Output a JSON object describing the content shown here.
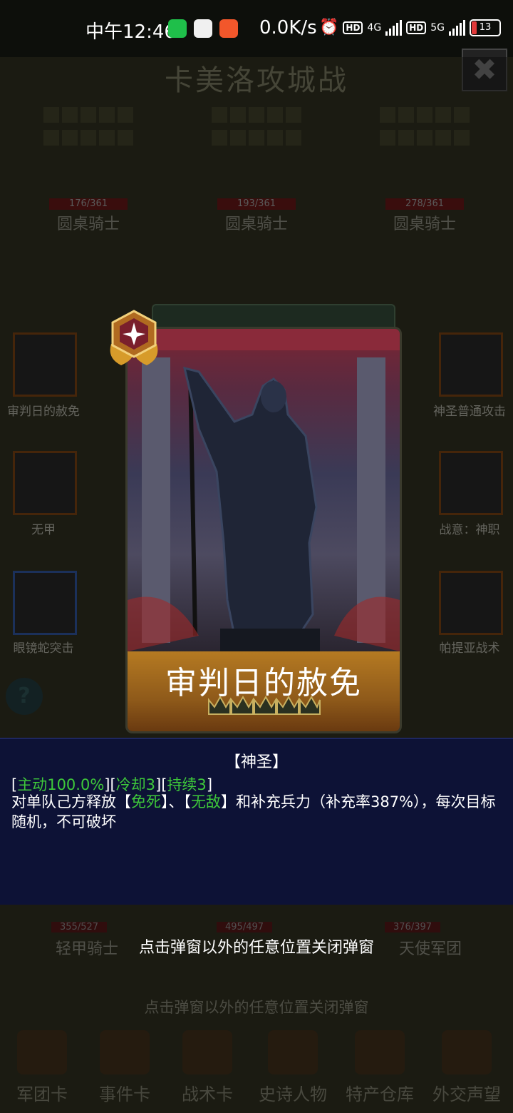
{
  "status_bar": {
    "time": "中午12:46",
    "net_speed": "0.0K/s",
    "network_1": "4G",
    "network_2": "5G",
    "battery": "13"
  },
  "game": {
    "title": "卡美洛攻城战",
    "top_units": [
      {
        "hp": "176/361",
        "name": "圆桌骑士"
      },
      {
        "hp": "193/361",
        "name": "圆桌骑士"
      },
      {
        "hp": "278/361",
        "name": "圆桌骑士"
      }
    ],
    "left_cards": [
      "审判日的赦免",
      "无甲",
      "眼镜蛇突击"
    ],
    "right_cards": [
      "神圣普通攻击",
      "战意：神职",
      "帕提亚战术"
    ],
    "help_icon": "?",
    "bottom_units": [
      {
        "hp": "355/527",
        "name": "轻甲骑士"
      },
      {
        "hp": "495/497",
        "name": ""
      },
      {
        "hp": "376/397",
        "name": "天使军团"
      }
    ],
    "bottom_hint": "点击弹窗以外的任意位置关闭弹窗",
    "nav": [
      "军团卡",
      "事件卡",
      "战术卡",
      "史诗人物",
      "特产仓库",
      "外交声望"
    ]
  },
  "popup": {
    "card_title": "审判日的赦免",
    "category": "【神圣】",
    "tags": {
      "active_label": "主动100.0%",
      "cooldown_label": "冷却3",
      "duration_label": "持续3"
    },
    "body_1": "对单队己方释放【",
    "effect_1": "免死",
    "body_2": "】、【",
    "effect_2": "无敌",
    "body_3": "】和补充兵力（补充率387%），每次目标随机，不可破坏",
    "close_hint": "点击弹窗以外的任意位置关闭弹窗"
  },
  "colors": {
    "effect_green": "#3ec93a",
    "panel_bg": "#0d1236",
    "banner_gold": "#b57a22"
  }
}
